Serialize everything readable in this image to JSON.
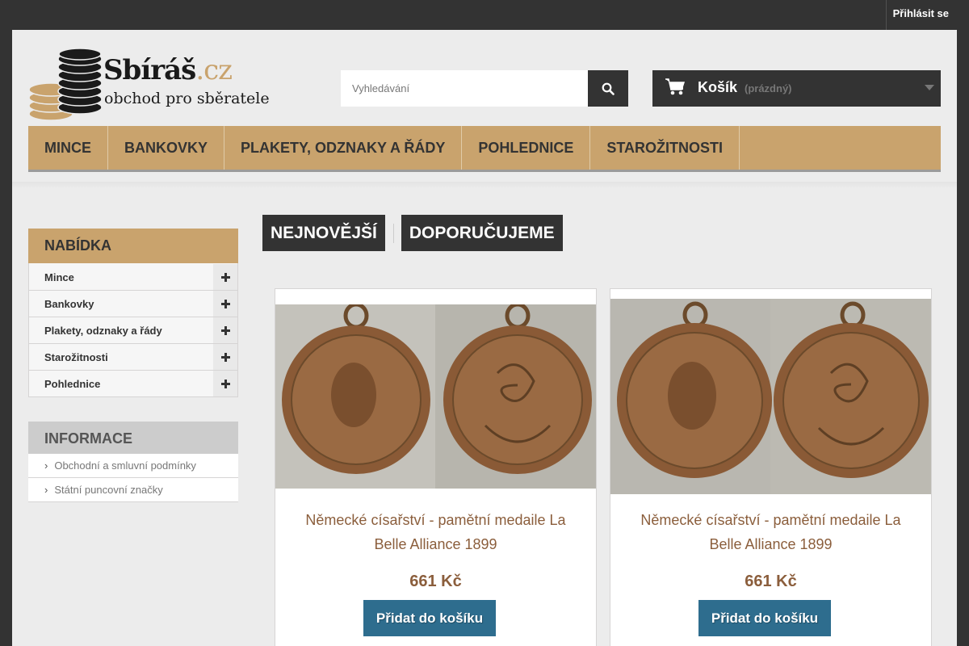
{
  "topbar": {
    "login_label": "Přihlásit se"
  },
  "logo": {
    "name": "Sbíráš",
    "tld": ".cz",
    "tagline": "obchod pro sběratele"
  },
  "search": {
    "placeholder": "Vyhledávání",
    "icon": "search-icon"
  },
  "cart": {
    "label": "Košík",
    "status": "(prázdný)",
    "icon": "cart-icon"
  },
  "menu": {
    "items": [
      "MINCE",
      "BANKOVKY",
      "PLAKETY, ODZNAKY A ŘÁDY",
      "POHLEDNICE",
      "STAROŽITNOSTI"
    ]
  },
  "sidebar": {
    "title": "NABÍDKA",
    "categories": [
      "Mince",
      "Bankovky",
      "Plakety, odznaky a řády",
      "Starožitnosti",
      "Pohlednice"
    ]
  },
  "info": {
    "title": "INFORMACE",
    "links": [
      "Obchodní a smluvní podmínky",
      "Státní puncovní značky"
    ]
  },
  "tabs": [
    "NEJNOVĚJŠÍ",
    "DOPORUČUJEME"
  ],
  "products": [
    {
      "name": "Německé císařství - pamětní medaile La Belle Alliance 1899",
      "price": "661 Kč",
      "button": "Přidat do košíku"
    },
    {
      "name": "Německé císařství - pamětní medaile La Belle Alliance 1899",
      "price": "661 Kč",
      "button": "Přidat do košíku"
    }
  ],
  "colors": {
    "accent": "#c9a36d",
    "dark": "#333333",
    "button": "#2e6d8e",
    "price": "#8b5e3c"
  }
}
